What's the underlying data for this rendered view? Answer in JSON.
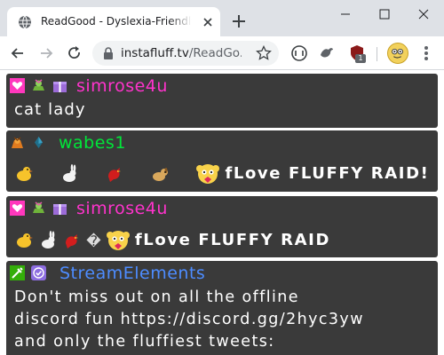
{
  "browser": {
    "tab_title": "ReadGood - Dyslexia-Friendly Tw",
    "url_host": "instafluff.tv",
    "url_path": "/ReadGo...",
    "ext_badge_count": "1",
    "colors": {
      "tabstrip": "#dee1e6",
      "omnibox": "#f1f3f4"
    }
  },
  "chat": {
    "colors": {
      "bubble": "#3a3a3a",
      "text": "#ffffff"
    },
    "messages": [
      {
        "username": "simrose4u",
        "name_color": "#ff33cc",
        "badges": [
          "heart-badge",
          "sub-gift-badge",
          "gift-badge"
        ],
        "text": "cat lady"
      },
      {
        "username": "wabes1",
        "name_color": "#00e639",
        "badges": [
          "cheer-badge",
          "bits-badge"
        ],
        "emotes": [
          "chick-emote",
          "rabbit-emote",
          "cardinal-emote",
          "dog-emote",
          "fluffy-emote"
        ],
        "text": "fLove FLUFFY RAID!"
      },
      {
        "username": "simrose4u",
        "name_color": "#ff33cc",
        "badges": [
          "heart-badge",
          "sub-gift-badge",
          "gift-badge"
        ],
        "emotes": [
          "chick-emote",
          "rabbit-emote",
          "cardinal-emote",
          "fluffy-emote"
        ],
        "replacement_char": "�",
        "text": "fLove FLUFFY RAID"
      },
      {
        "username": "StreamElements",
        "name_color": "#4d8cff",
        "badges": [
          "moderator-badge",
          "verified-badge"
        ],
        "lines": [
          "Don't miss out on all the offline",
          "discord fun https://discord.gg/2hyc3yw",
          "and only the fluffiest tweets:"
        ]
      }
    ]
  }
}
